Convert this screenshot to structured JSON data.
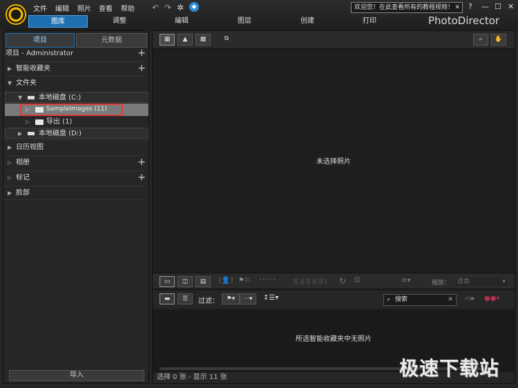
{
  "menu": [
    "文件",
    "编辑",
    "照片",
    "查看",
    "帮助"
  ],
  "notice": "欢迎您！在此查看所有的教程视频！",
  "window_controls": [
    "?",
    "—",
    "☐",
    "✕"
  ],
  "tabs": [
    "图库",
    "调整",
    "编辑",
    "图层",
    "创建",
    "打印"
  ],
  "brand": "PhotoDirector",
  "panel_tabs": {
    "project": "项目",
    "metadata": "元数据"
  },
  "tree": {
    "project": "项目 - Administrator",
    "smart_collections": "智能收藏夹",
    "folders": "文件夹",
    "drive_c": "本地磁盘 (C:)",
    "sample_images": "SampleImages (11)",
    "export": "导出 (1)",
    "drive_d": "本地磁盘 (D:)",
    "calendar": "日历视图",
    "albums": "相册",
    "tags": "标记",
    "faces": "脸部"
  },
  "import_label": "导入",
  "viewer": {
    "empty_text": "未选择照片"
  },
  "zoom": {
    "label": "缩放：",
    "value": "适合"
  },
  "filter": {
    "label": "过滤："
  },
  "search": {
    "placeholder": "搜索"
  },
  "filmstrip": {
    "empty_text": "所选智能收藏夹中无照片"
  },
  "status": "选择 0 张 - 显示 11 张",
  "watermark": "极速下载站",
  "colors": {
    "accent": "#1e6fb0",
    "highlight_box": "#e03a3a",
    "logo": "#f2b700"
  }
}
